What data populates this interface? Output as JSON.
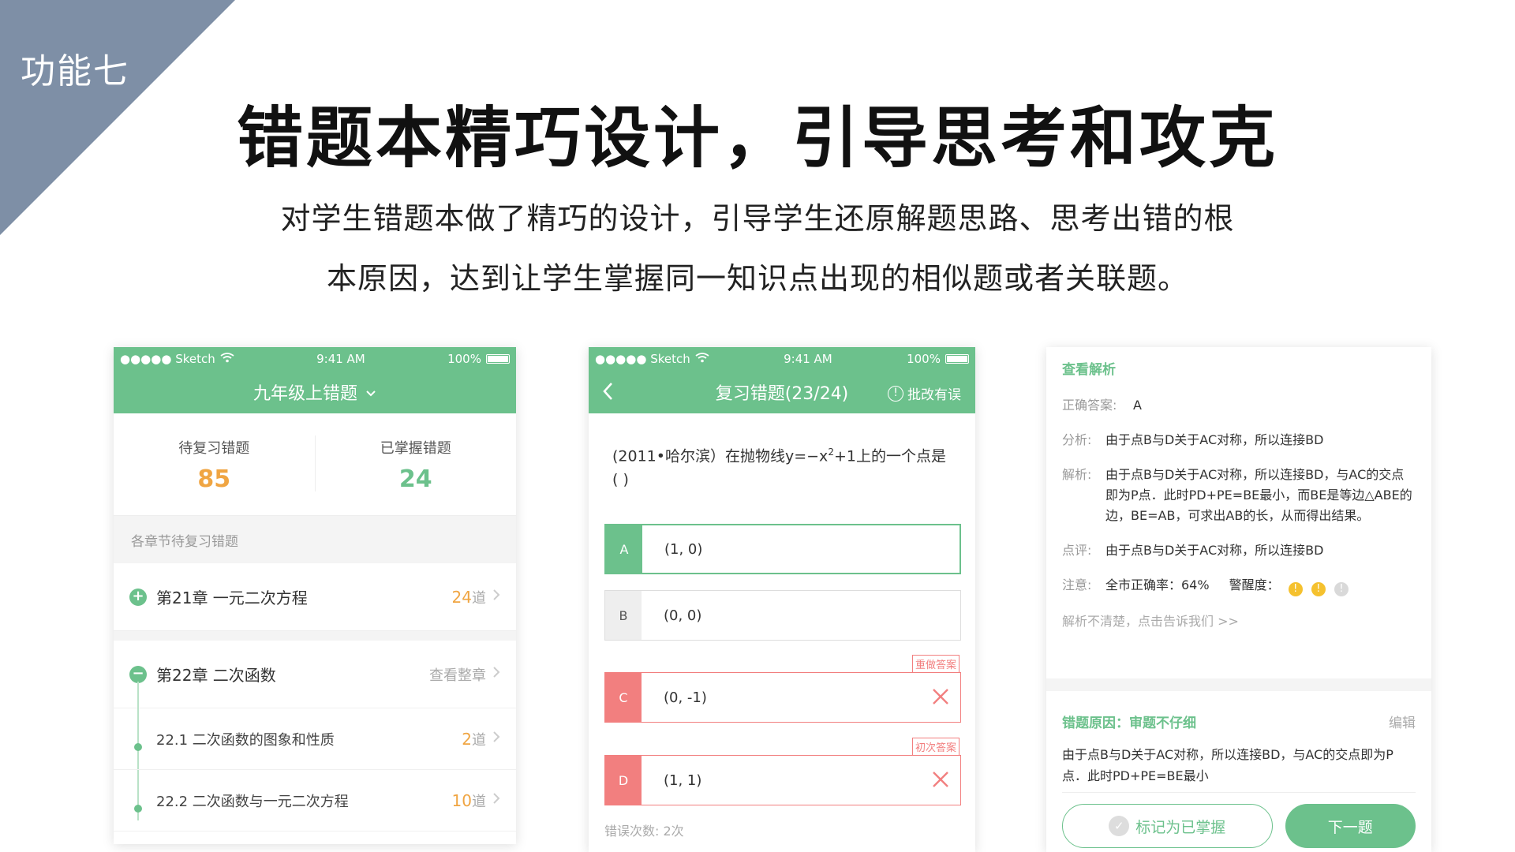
{
  "colors": {
    "accent": "#6cc18c",
    "orange": "#f0a542",
    "error": "#f27f7f",
    "corner": "#7e8fa6"
  },
  "corner_label": "功能七",
  "title": "错题本精巧设计，引导思考和攻克",
  "subtitle_line1": "对学生错题本做了精巧的设计，引导学生还原解题思路、思考出错的根",
  "subtitle_line2": "本原因，达到让学生掌握同一知识点出现的相似题或者关联题。",
  "status": {
    "carrier": "●●●●● Sketch",
    "wifi": "wifi-icon",
    "time": "9:41 AM",
    "battery": "100%"
  },
  "phone1": {
    "nav_title": "九年级上错题",
    "pending_label": "待复习错题",
    "pending_value": "85",
    "mastered_label": "已掌握错题",
    "mastered_value": "24",
    "section_header": "各章节待复习错题",
    "chapter21": {
      "icon": "+",
      "title": "第21章  一元二次方程",
      "count": "24",
      "unit": "道"
    },
    "chapter22": {
      "icon": "−",
      "title": "第22章  二次函数",
      "action": "查看整章"
    },
    "sub1": {
      "title": "22.1 二次函数的图象和性质",
      "count": "2",
      "unit": "道"
    },
    "sub2": {
      "title": "22.2 二次函数与一元二次方程",
      "count": "10",
      "unit": "道"
    }
  },
  "phone2": {
    "nav_title": "复习错题(23/24)",
    "report_icon": "!",
    "report_label": "批改有误",
    "question_main": "(2011•哈尔滨）在抛物线y=−x",
    "question_sup": "2",
    "question_rest": "+1上的一个点是",
    "question_bracket": "(        )",
    "options": [
      {
        "letter": "A",
        "text": "(1,  0)"
      },
      {
        "letter": "B",
        "text": "(0,  0)"
      },
      {
        "letter": "C",
        "text": "(0,  -1)",
        "tag": "重做答案"
      },
      {
        "letter": "D",
        "text": "(1,  1)",
        "tag": "初次答案"
      }
    ],
    "error_count": "错误次数: 2次"
  },
  "phone3": {
    "analysis_title": "查看解析",
    "answer_label": "正确答案:",
    "answer_value": "A",
    "analysis_label": "分析:",
    "analysis_text": "由于点B与D关于AC对称，所以连接BD",
    "solution_label": "解析:",
    "solution_text": "由于点B与D关于AC对称，所以连接BD，与AC的交点即为P点．此时PD+PE=BE最小，而BE是等边△ABE的边，BE=AB，可求出AB的长，从而得出结果。",
    "comment_label": "点评:",
    "comment_text": "由于点B与D关于AC对称，所以连接BD",
    "note_label": "注意:",
    "note_rate": "全市正确率：64%",
    "note_alert": "警醒度：",
    "alert_icon": "!",
    "feedback": "解析不清楚，点击告诉我们 >>",
    "reason_title": "错题原因：审题不仔细",
    "reason_edit": "编辑",
    "reason_text": "由于点B与D关于AC对称，所以连接BD，与AC的交点即为P点．此时PD+PE=BE最小",
    "mark_button": "标记为已掌握",
    "check_icon": "✓",
    "next_button": "下一题"
  }
}
